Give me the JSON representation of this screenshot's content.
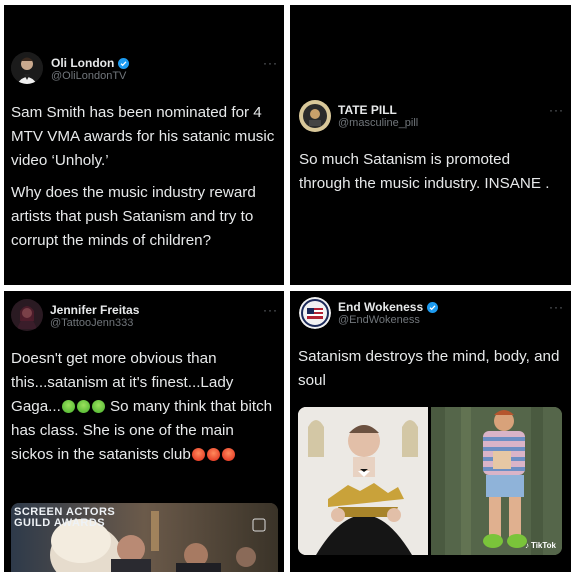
{
  "tweets": [
    {
      "name": "Oli London",
      "handle": "@OliLondonTV",
      "verified": true,
      "more": "···",
      "paragraphs": [
        "Sam Smith has been nominated for 4 MTV VMA awards for his satanic music video ‘Unholy.’",
        "Why does the music industry reward artists that push Satanism and try to corrupt the minds of children?"
      ]
    },
    {
      "name": "TATE PILL",
      "handle": "@masculine_pill",
      "verified": false,
      "more": "···",
      "paragraphs": [
        "So much Satanism is promoted through the music industry. INSANE ."
      ]
    },
    {
      "name": "Jennifer Freitas",
      "handle": "@TattooJenn333",
      "verified": false,
      "more": "···",
      "text_part1": "Doesn't get more obvious than this...satanism at it's finest...Lady Gaga...",
      "text_part2": " So many think that bitch has class. She is one of the main sickos in the satanists club",
      "media_text": "SCREEN ACTORS GUILD AWARDS"
    },
    {
      "name": "End Wokeness",
      "handle": "@EndWokeness",
      "verified": true,
      "more": "···",
      "paragraphs": [
        "Satanism destroys the mind, body, and soul"
      ],
      "media_watermark": "TikTok"
    }
  ],
  "colors": {
    "background": "#000000",
    "text": "#e7e9ea",
    "secondary": "#71767b",
    "verified": "#1d9bf0"
  }
}
